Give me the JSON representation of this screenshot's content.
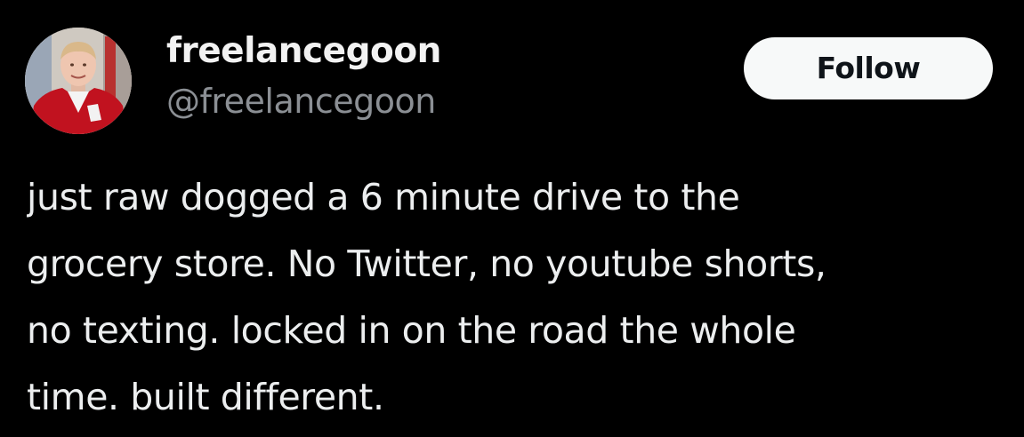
{
  "post": {
    "author": {
      "display_name": "freelancegoon",
      "handle": "@freelancegoon",
      "avatar_icon": "user-avatar-photo"
    },
    "follow_label": "Follow",
    "text_lines": [
      "just raw dogged a 6 minute drive to the",
      "grocery store. No Twitter, no youtube shorts,",
      "no texting. locked in on the road the whole",
      "time. built different."
    ]
  },
  "colors": {
    "background": "#000000",
    "text": "#e7e9ea",
    "muted": "#8b8f94",
    "button_bg": "#f7f9f9",
    "button_text": "#0f1419"
  }
}
